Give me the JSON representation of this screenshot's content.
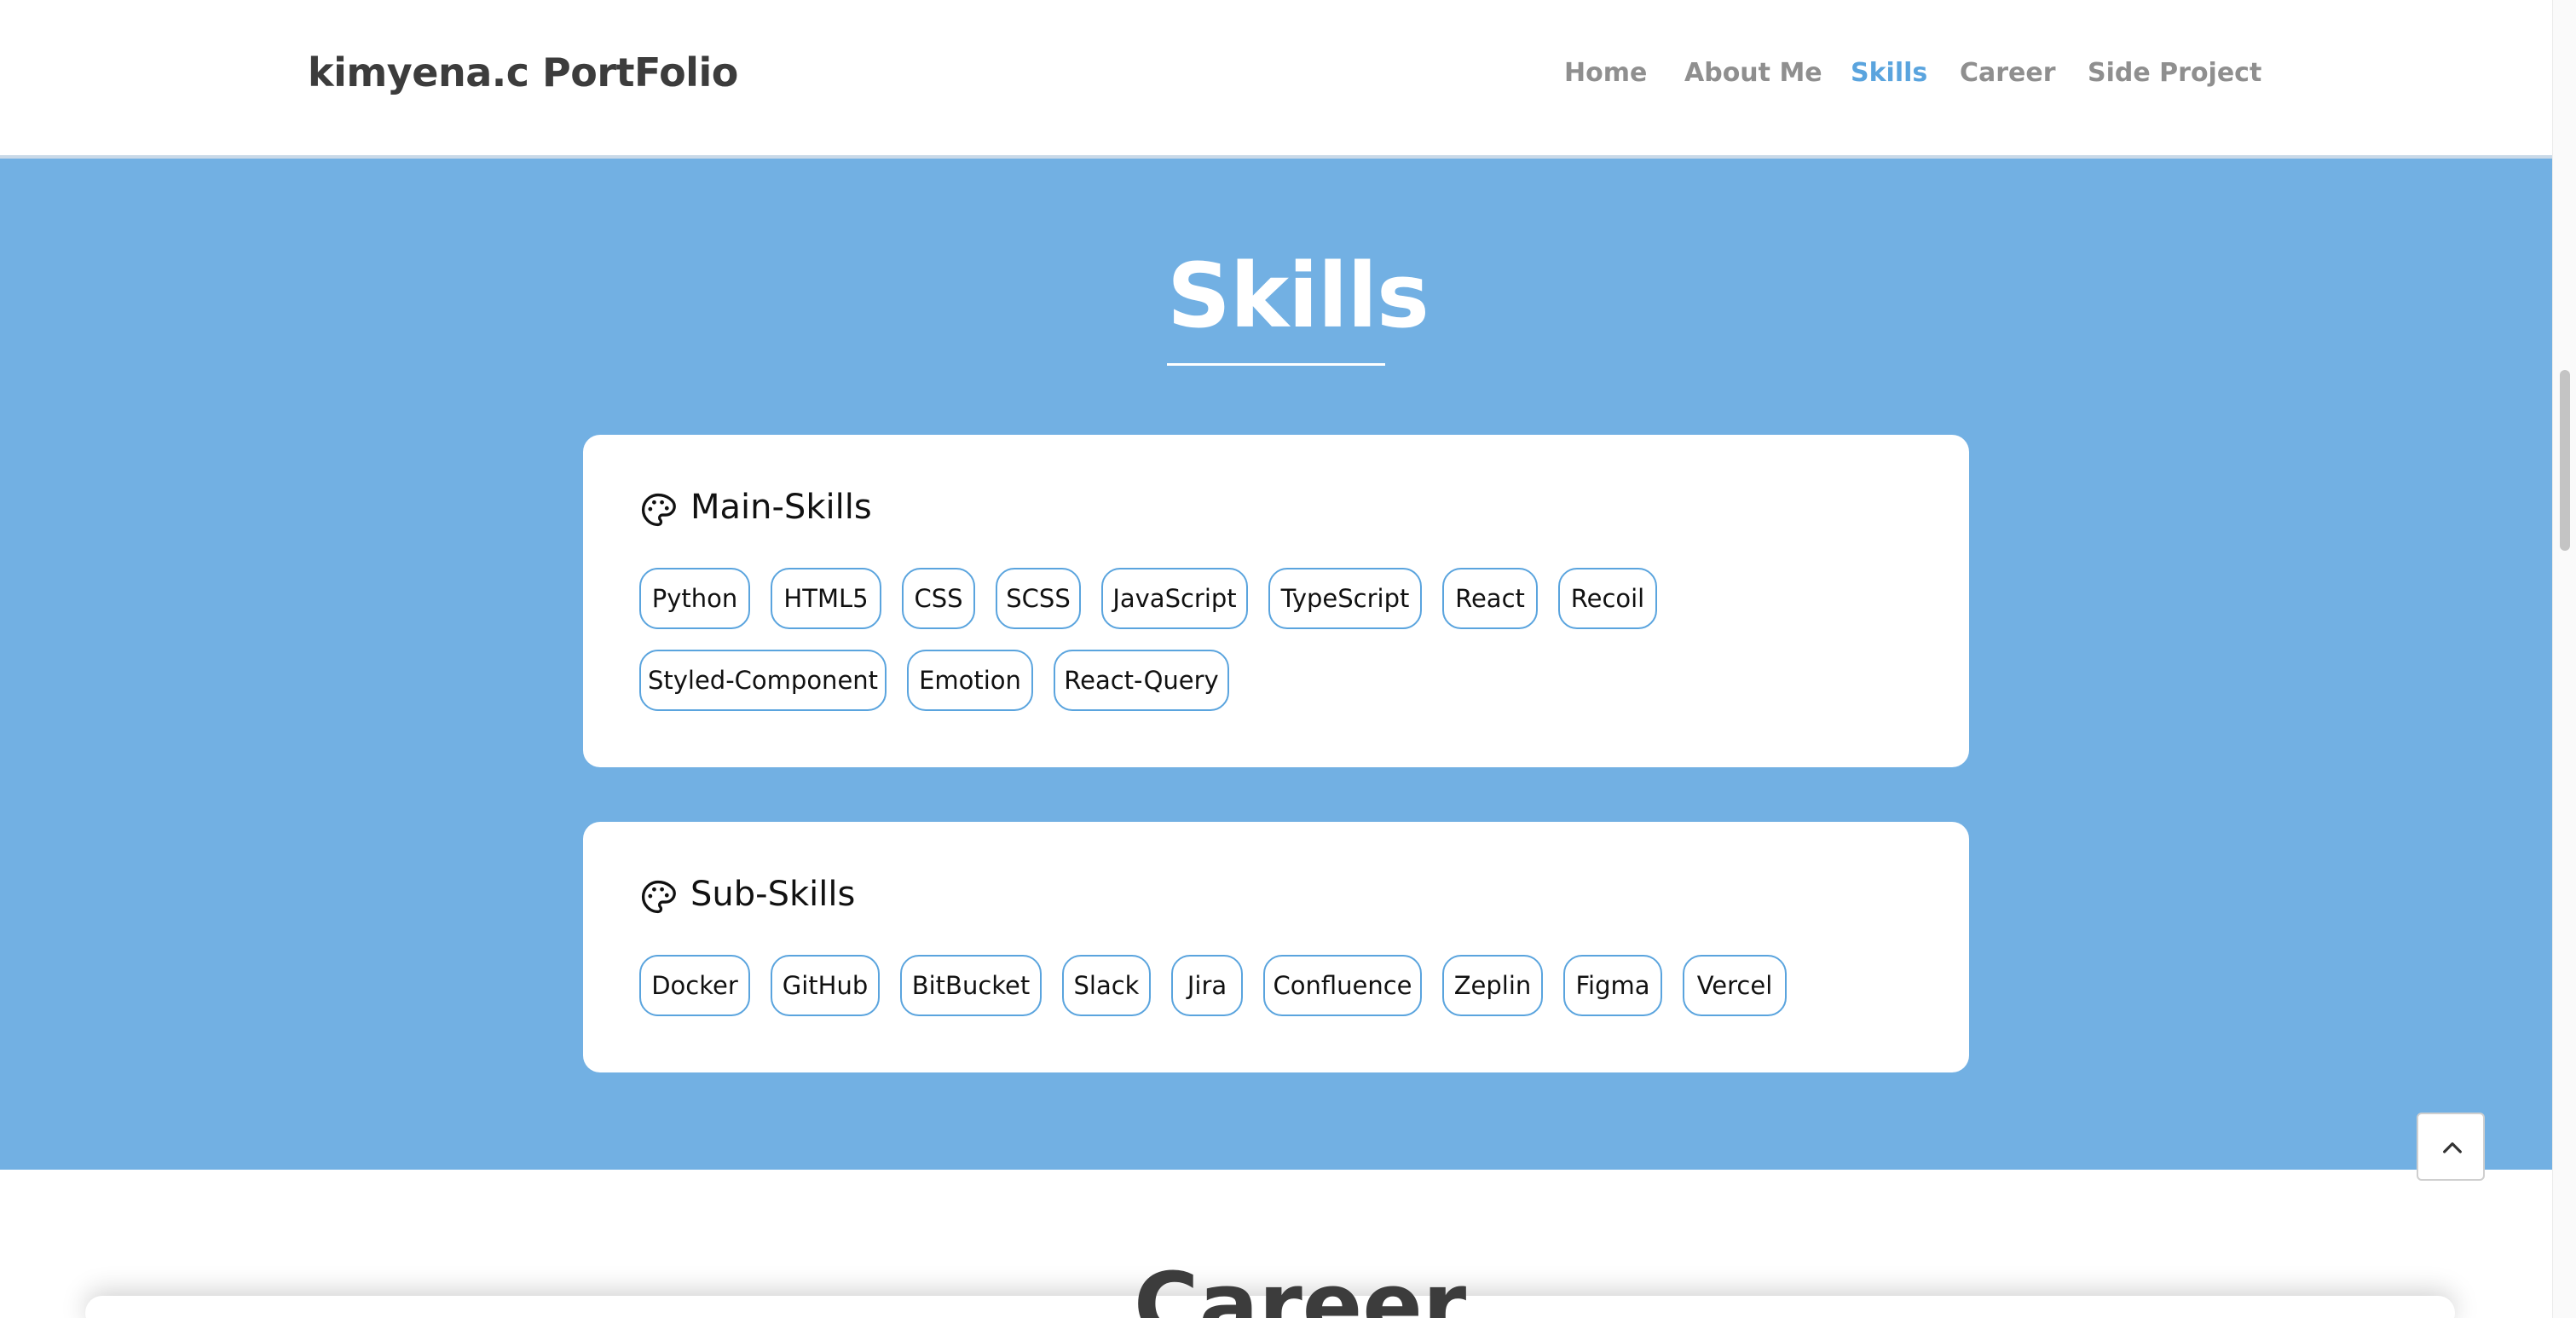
{
  "header": {
    "logo": "kimyena.c PortFolio",
    "nav": [
      {
        "label": "Home",
        "active": false
      },
      {
        "label": "About Me",
        "active": false
      },
      {
        "label": "Skills",
        "active": true
      },
      {
        "label": "Career",
        "active": false
      },
      {
        "label": "Side Project",
        "active": false
      }
    ]
  },
  "skills": {
    "title": "Skills",
    "main": {
      "title": "Main-Skills",
      "icon": "palette-icon",
      "tags": [
        "Python",
        "HTML5",
        "CSS",
        "SCSS",
        "JavaScript",
        "TypeScript",
        "React",
        "Recoil",
        "Styled-Component",
        "Emotion",
        "React-Query"
      ]
    },
    "sub": {
      "title": "Sub-Skills",
      "icon": "palette-icon",
      "tags": [
        "Docker",
        "GitHub",
        "BitBucket",
        "Slack",
        "Jira",
        "Confluence",
        "Zeplin",
        "Figma",
        "Vercel"
      ]
    }
  },
  "career": {
    "title": "Career"
  },
  "scroll_top": {
    "icon": "chevron-up-icon"
  },
  "colors": {
    "section_bg": "#72b0e3",
    "accent": "#5aa4de",
    "nav_inactive": "#8f8f8f",
    "logo": "#3c3c3c"
  }
}
